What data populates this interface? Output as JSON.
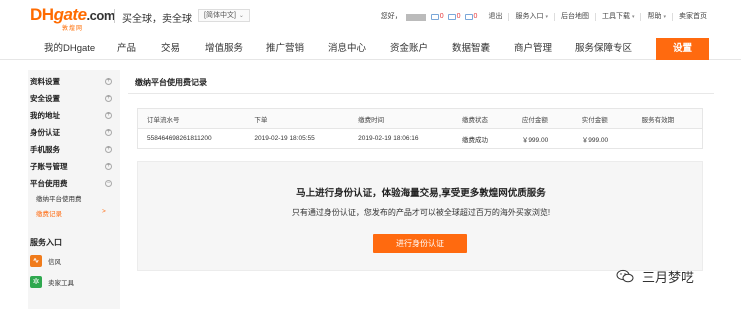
{
  "header": {
    "logo_text": "DHgate.com",
    "logo_sub": "敦煌网",
    "slogan": "买全球，卖全球",
    "language": "[简体中文]",
    "greeting": "您好，",
    "msg_count_1": "0",
    "msg_count_2": "0",
    "msg_count_3": "0",
    "logout": "退出",
    "service_entry": "服务入口",
    "backend_map": "后台地图",
    "tool_download": "工具下载",
    "help": "帮助",
    "seller_home": "卖家首页"
  },
  "nav": {
    "items": [
      "我的DHgate",
      "产品",
      "交易",
      "增值服务",
      "推广营销",
      "消息中心",
      "资金账户",
      "数据智囊",
      "商户管理",
      "服务保障专区"
    ],
    "settings": "设置"
  },
  "sidebar": {
    "groups": [
      "资料设置",
      "安全设置",
      "我的地址",
      "身份认证",
      "手机服务",
      "子账号管理",
      "平台使用费"
    ],
    "sub_items": [
      "缴纳平台使用费",
      "缴费记录"
    ],
    "active_arrow": ">",
    "section_title": "服务入口",
    "tools": [
      "信风",
      "卖家工具"
    ]
  },
  "content": {
    "title": "缴纳平台使用费记录",
    "table": {
      "headers": [
        "订单流水号",
        "下单",
        "缴费时间",
        "缴费状态",
        "应付金额",
        "实付金额",
        "服务有效期"
      ],
      "rows": [
        [
          "558464698261811200",
          "2019-02-19 18:05:55",
          "2019-02-19 18:06:16",
          "缴费成功",
          "￥999.00",
          "￥999.00",
          ""
        ]
      ]
    },
    "verify": {
      "title": "马上进行身份认证，体验海量交易,享受更多敦煌网优质服务",
      "desc": "只有通过身份认证，您发布的产品才可以被全球超过百万的海外买家浏览!",
      "button": "进行身份认证"
    }
  },
  "watermark": {
    "text": "三月梦呓",
    "icon": "wechat-icon"
  },
  "colors": {
    "accent": "#ff6a0f",
    "success": "#2fa84f"
  }
}
